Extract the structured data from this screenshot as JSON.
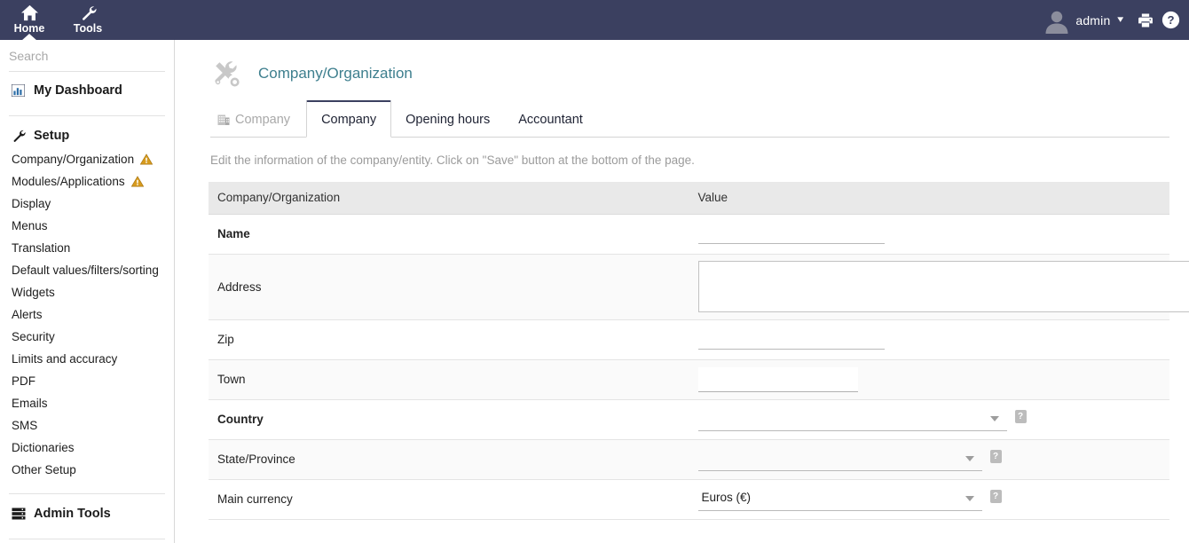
{
  "topbar": {
    "nav": [
      {
        "label": "Home",
        "icon": "home-icon",
        "active": true
      },
      {
        "label": "Tools",
        "icon": "wrench-icon",
        "active": false
      }
    ],
    "username": "admin",
    "caret": "▾",
    "print_icon": "printer-icon",
    "help_icon": "help-circle-icon"
  },
  "sidebar": {
    "search_placeholder": "Search",
    "dashboard": {
      "label": "My Dashboard",
      "icon": "chart-bar-icon"
    },
    "setup": {
      "label": "Setup",
      "icon": "wrench-icon"
    },
    "setup_items": [
      {
        "label": "Company/Organization",
        "warning": true
      },
      {
        "label": "Modules/Applications",
        "warning": true
      },
      {
        "label": "Display",
        "warning": false
      },
      {
        "label": "Menus",
        "warning": false
      },
      {
        "label": "Translation",
        "warning": false
      },
      {
        "label": "Default values/filters/sorting",
        "warning": false
      },
      {
        "label": "Widgets",
        "warning": false
      },
      {
        "label": "Alerts",
        "warning": false
      },
      {
        "label": "Security",
        "warning": false
      },
      {
        "label": "Limits and accuracy",
        "warning": false
      },
      {
        "label": "PDF",
        "warning": false
      },
      {
        "label": "Emails",
        "warning": false
      },
      {
        "label": "SMS",
        "warning": false
      },
      {
        "label": "Dictionaries",
        "warning": false
      },
      {
        "label": "Other Setup",
        "warning": false
      }
    ],
    "admin_tools": {
      "label": "Admin Tools",
      "icon": "server-icon"
    }
  },
  "page": {
    "title": "Company/Organization",
    "title_icon": "tools-icon",
    "title_color": "#3e7f8e",
    "hint": "Edit the information of the company/entity. Click on \"Save\" button at the bottom of the page."
  },
  "tabs": {
    "section_label": "Company",
    "section_icon": "building-icon",
    "items": [
      {
        "label": "Company",
        "active": true
      },
      {
        "label": "Opening hours",
        "active": false
      },
      {
        "label": "Accountant",
        "active": false
      }
    ]
  },
  "table": {
    "headers": [
      "Company/Organization",
      "Value"
    ],
    "rows": [
      {
        "label": "Name",
        "required": true,
        "control": "text",
        "value": "",
        "help": false,
        "row_style": "plain",
        "height": "tall"
      },
      {
        "label": "Address",
        "required": false,
        "control": "textarea",
        "value": "",
        "help": false,
        "row_style": "alt",
        "height": "xtall"
      },
      {
        "label": "Zip",
        "required": false,
        "control": "text",
        "value": "",
        "help": false,
        "row_style": "plain",
        "height": "tall"
      },
      {
        "label": "Town",
        "required": false,
        "control": "boxtext",
        "value": "",
        "help": false,
        "row_style": "alt",
        "height": "tall"
      },
      {
        "label": "Country",
        "required": true,
        "control": "select",
        "value": "",
        "help": true,
        "row_style": "plain",
        "height": "tall"
      },
      {
        "label": "State/Province",
        "required": false,
        "control": "select",
        "value": "",
        "help": true,
        "row_style": "alt",
        "height": "tall"
      },
      {
        "label": "Main currency",
        "required": false,
        "control": "select",
        "value": "Euros (€)",
        "help": true,
        "row_style": "plain",
        "height": "tall"
      }
    ],
    "help_glyph": "?"
  },
  "colors": {
    "header_bg": "#3b4060",
    "accent_title": "#3e7f8e",
    "required_label": "#1b2252",
    "warning": "#d79b1e",
    "table_header_bg": "#e9e9e9"
  }
}
